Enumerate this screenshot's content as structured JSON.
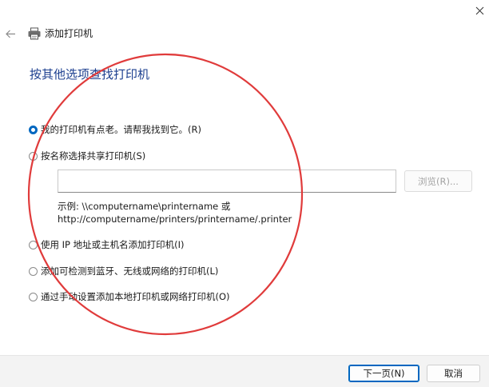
{
  "window": {
    "title": "添加打印机",
    "close_icon": "close-icon",
    "back_icon": "back-arrow-icon",
    "app_icon": "printer-icon"
  },
  "page": {
    "heading": "按其他选项查找打印机"
  },
  "options": [
    {
      "label": "我的打印机有点老。请帮我找到它。(R)",
      "checked": true
    },
    {
      "label": "按名称选择共享打印机(S)",
      "checked": false
    },
    {
      "label": "使用 IP 地址或主机名添加打印机(I)",
      "checked": false
    },
    {
      "label": "添加可检测到蓝牙、无线或网络的打印机(L)",
      "checked": false
    },
    {
      "label": "通过手动设置添加本地打印机或网络打印机(O)",
      "checked": false
    }
  ],
  "share": {
    "input_value": "",
    "browse_label": "浏览(R)...",
    "example_line1": "示例: \\\\computername\\printername 或",
    "example_line2": "http://computername/printers/printername/.printer"
  },
  "footer": {
    "next_label": "下一页(N)",
    "cancel_label": "取消"
  },
  "colors": {
    "accent": "#0067c0",
    "heading": "#1c3f8f",
    "annotation_circle": "#e03b3b"
  }
}
